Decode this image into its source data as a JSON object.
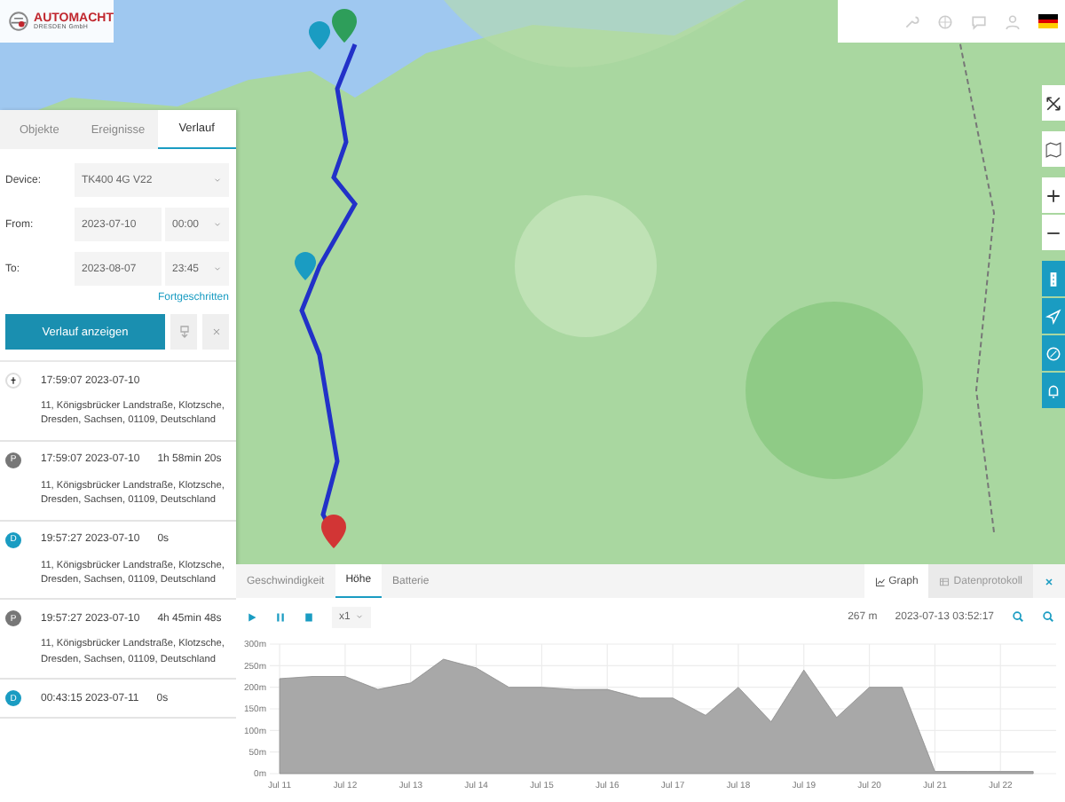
{
  "logo": {
    "name": "AUTOMACHT",
    "subtitle": "DRESDEN GmbH"
  },
  "side_panel": {
    "tabs": [
      {
        "label": "Objekte",
        "selected": false
      },
      {
        "label": "Ereignisse",
        "selected": false
      },
      {
        "label": "Verlauf",
        "selected": true
      }
    ],
    "device": {
      "label": "Device:",
      "value": "TK400 4G V22"
    },
    "from": {
      "label": "From:",
      "date": "2023-07-10",
      "time": "00:00"
    },
    "to": {
      "label": "To:",
      "date": "2023-08-07",
      "time": "23:45"
    },
    "advanced_link": "Fortgeschritten",
    "show_button": "Verlauf anzeigen",
    "events": [
      {
        "kind": "start",
        "time": "17:59:07 2023-07-10",
        "address": "11, Königsbrücker Landstraße, Klotzsche, Dresden, Sachsen, 01109, Deutschland"
      },
      {
        "kind": "parking",
        "badge": "P",
        "time": "17:59:07 2023-07-10",
        "duration": "1h 58min 20s",
        "address": "11, Königsbrücker Landstraße, Klotzsche, Dresden, Sachsen, 01109, Deutschland"
      },
      {
        "kind": "driving",
        "badge": "D",
        "time": "19:57:27 2023-07-10",
        "duration": "0s",
        "address": "11, Königsbrücker Landstraße, Klotzsche, Dresden, Sachsen, 01109, Deutschland"
      },
      {
        "kind": "parking",
        "badge": "P",
        "time": "19:57:27 2023-07-10",
        "duration": "4h 45min 48s",
        "address": "11, Königsbrücker Landstraße, Klotzsche, Dresden, Sachsen, 01109, Deutschland"
      },
      {
        "kind": "driving",
        "badge": "D",
        "time": "00:43:15 2023-07-11",
        "duration": "0s"
      }
    ]
  },
  "bottom_panel": {
    "tabs": [
      {
        "label": "Geschwindigkeit",
        "selected": false
      },
      {
        "label": "Höhe",
        "selected": true
      },
      {
        "label": "Batterie",
        "selected": false
      }
    ],
    "views": [
      {
        "label": "Graph",
        "selected": true
      },
      {
        "label": "Datenprotokoll",
        "selected": false
      }
    ],
    "speed": "x1",
    "reading": "267 m",
    "timestamp": "2023-07-13 03:52:17",
    "chart_data": {
      "type": "area",
      "grid": true,
      "categories": [
        "Jul 11",
        null,
        "Jul 12",
        null,
        "Jul 13",
        null,
        "Jul 14",
        null,
        "Jul 15",
        null,
        "Jul 16",
        null,
        "Jul 17",
        null,
        "Jul 18",
        null,
        "Jul 19",
        null,
        "Jul 20",
        null,
        "Jul 21",
        null,
        "Jul 22",
        null
      ],
      "series": [
        {
          "color": "#a8a8a8",
          "values": [
            220,
            225,
            225,
            195,
            210,
            265,
            245,
            200,
            200,
            195,
            195,
            175,
            175,
            135,
            200,
            120,
            240,
            130,
            200,
            200,
            5,
            5,
            5,
            5
          ]
        }
      ],
      "ylim": [
        0,
        300
      ],
      "yticks": [
        {
          "value": 0,
          "label": "0m"
        },
        {
          "value": 50,
          "label": "50m"
        },
        {
          "value": 100,
          "label": "100m"
        },
        {
          "value": 150,
          "label": "150m"
        },
        {
          "value": 200,
          "label": "200m"
        },
        {
          "value": 250,
          "label": "250m"
        },
        {
          "value": 300,
          "label": "300m"
        }
      ]
    }
  }
}
